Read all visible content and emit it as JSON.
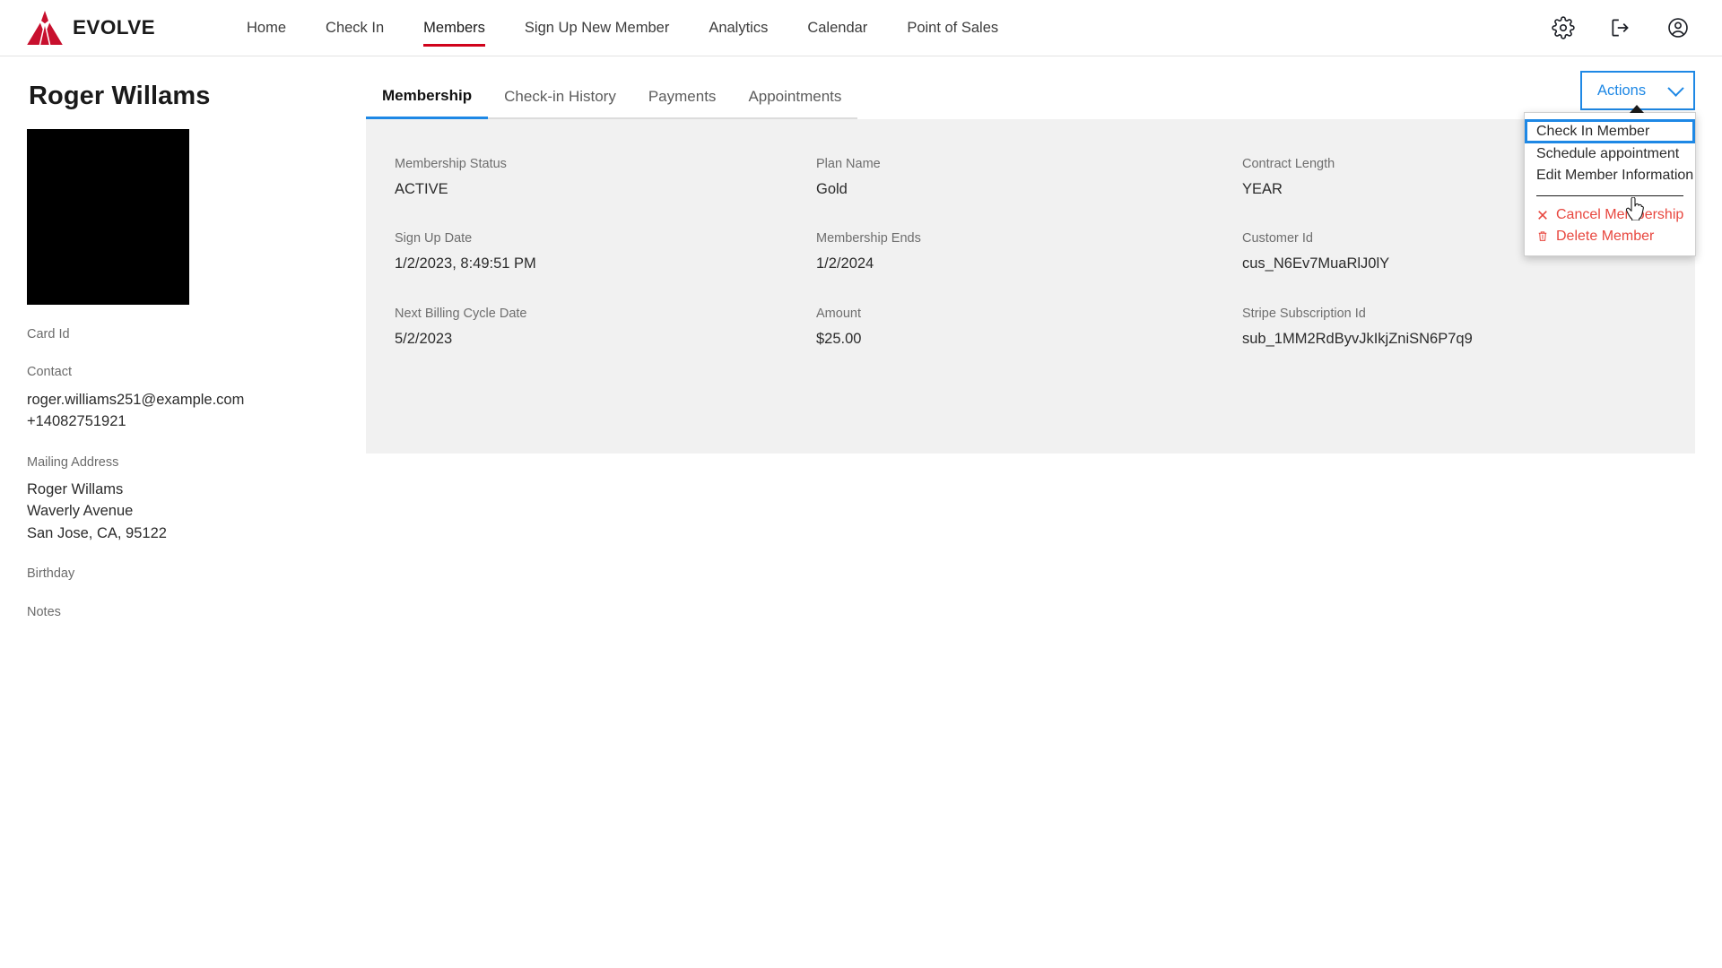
{
  "brand": {
    "name": "EVOLVE",
    "logo_icon": "evolve-triangle-logo",
    "accent_color": "#c8102e"
  },
  "nav": {
    "links": [
      {
        "label": "Home",
        "active": false
      },
      {
        "label": "Check In",
        "active": false
      },
      {
        "label": "Members",
        "active": true
      },
      {
        "label": "Sign Up New Member",
        "active": false
      },
      {
        "label": "Analytics",
        "active": false
      },
      {
        "label": "Calendar",
        "active": false
      },
      {
        "label": "Point of Sales",
        "active": false
      }
    ],
    "icons": [
      {
        "name": "gear-icon"
      },
      {
        "name": "logout-icon"
      },
      {
        "name": "account-circle-icon"
      }
    ]
  },
  "sidebar": {
    "member_name": "Roger Willams",
    "photo": "member-photo-placeholder",
    "fields": [
      {
        "label": "Card Id",
        "values": []
      },
      {
        "label": "Contact",
        "values": [
          "roger.williams251@example.com",
          "+14082751921"
        ]
      },
      {
        "label": "Mailing Address",
        "values": [
          "Roger Willams",
          "Waverly Avenue",
          "San Jose, CA, 95122"
        ]
      },
      {
        "label": "Birthday",
        "values": []
      },
      {
        "label": "Notes",
        "values": []
      }
    ]
  },
  "tabs": [
    {
      "label": "Membership",
      "active": true
    },
    {
      "label": "Check-in History",
      "active": false
    },
    {
      "label": "Payments",
      "active": false
    },
    {
      "label": "Appointments",
      "active": false
    }
  ],
  "actions": {
    "button_label": "Actions",
    "chevron_icon": "chevron-down-icon",
    "open": true,
    "accent_color": "#1e88e5",
    "danger_color": "#e8473f",
    "items": [
      {
        "label": "Check In Member",
        "kind": "normal",
        "highlighted": true
      },
      {
        "label": "Schedule appointment",
        "kind": "normal",
        "highlighted": false
      },
      {
        "label": "Edit Member Information",
        "kind": "normal",
        "highlighted": false
      }
    ],
    "danger_items": [
      {
        "label": "Cancel Membership",
        "icon": "close-x-icon"
      },
      {
        "label": "Delete Member",
        "icon": "trash-icon"
      }
    ]
  },
  "details": [
    {
      "label": "Membership Status",
      "value": "ACTIVE"
    },
    {
      "label": "Plan Name",
      "value": "Gold"
    },
    {
      "label": "Contract Length",
      "value": "YEAR"
    },
    {
      "label": "Sign Up Date",
      "value": "1/2/2023, 8:49:51 PM"
    },
    {
      "label": "Membership Ends",
      "value": "1/2/2024"
    },
    {
      "label": "Customer Id",
      "value": "cus_N6Ev7MuaRlJ0lY"
    },
    {
      "label": "Next Billing Cycle Date",
      "value": "5/2/2023"
    },
    {
      "label": "Amount",
      "value": "$25.00"
    },
    {
      "label": "Stripe Subscription Id",
      "value": "sub_1MM2RdByvJkIkjZniSN6P7q9"
    }
  ],
  "cursor": {
    "type": "pointer-hand-cursor"
  }
}
